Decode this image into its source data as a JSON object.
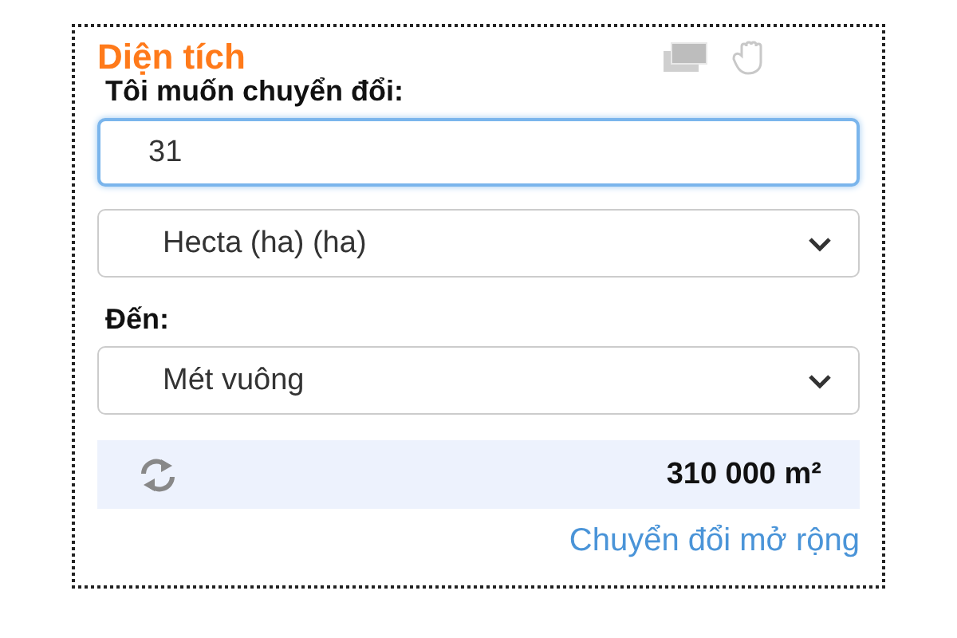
{
  "title": "Diện tích",
  "from_label": "Tôi muốn chuyển đổi:",
  "amount": {
    "value": "31"
  },
  "from_unit": {
    "value": "Hecta (ha) (ha)"
  },
  "to_label": "Đến:",
  "to_unit": {
    "value": "Mét vuông"
  },
  "result": "310 000 m²",
  "link": "Chuyển đổi mở rộng"
}
